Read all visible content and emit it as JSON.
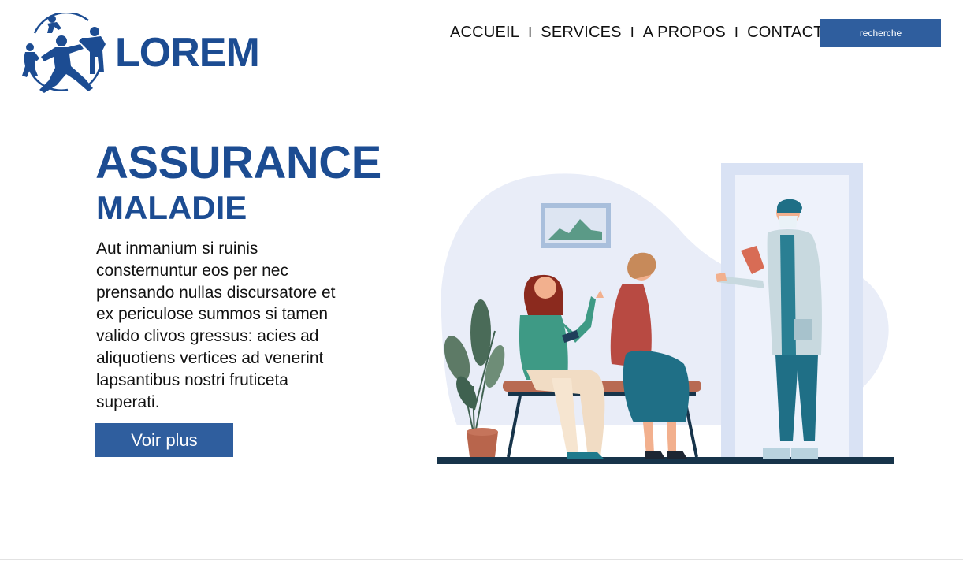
{
  "header": {
    "logo_text": "LOREM",
    "logo_icon": "family-figures-icon",
    "nav": [
      {
        "label": "ACCUEIL"
      },
      {
        "label": "SERVICES"
      },
      {
        "label": "A PROPOS"
      },
      {
        "label": "CONTACT"
      }
    ],
    "nav_separator": "I",
    "search_label": "recherche"
  },
  "hero": {
    "title": "ASSURANCE",
    "subtitle": "MALADIE",
    "body": "Aut inmanium si ruinis consternuntur eos per nec prensando nullas discursatore et ex periculose summos si tamen valido clivos gressus: acies ad aliquotiens vertices ad venerint lapsantibus nostri fruticeta superati.",
    "cta_label": "Voir plus"
  },
  "illustration": {
    "subject": "doctor-waiting-room-illustration"
  },
  "colors": {
    "brand": "#1c4c92",
    "button": "#2f5e9e",
    "blob": "#e9edf8",
    "door": "#d8e1f3"
  }
}
